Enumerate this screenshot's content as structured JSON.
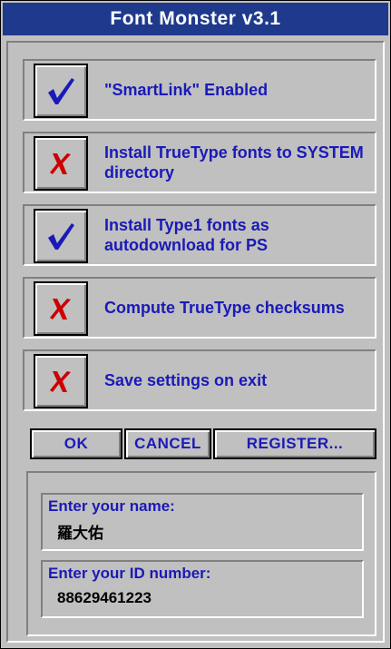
{
  "window": {
    "title": "Font Monster v3.1"
  },
  "options": [
    {
      "label": "\"SmartLink\" Enabled",
      "checked": true,
      "icon": "checkmark-icon"
    },
    {
      "label": "Install TrueType fonts to SYSTEM directory",
      "checked": false,
      "icon": "x-mark-icon"
    },
    {
      "label": "Install Type1 fonts as autodownload for PS",
      "checked": true,
      "icon": "checkmark-icon"
    },
    {
      "label": "Compute TrueType checksums",
      "checked": false,
      "icon": "x-mark-icon"
    },
    {
      "label": "Save settings on exit",
      "checked": false,
      "icon": "x-mark-icon"
    }
  ],
  "buttons": {
    "ok": "OK",
    "cancel": "CANCEL",
    "register": "REGISTER..."
  },
  "registration": {
    "name_label": "Enter your name:",
    "name_value": "羅大佑",
    "id_label": "Enter your ID number:",
    "id_value": "88629461223"
  },
  "colors": {
    "title_bar": "#1f3a8c",
    "text_accent": "#1a1ab8",
    "check": "#1a1ab8",
    "cross": "#cc0000",
    "face": "#c0c0c0"
  }
}
